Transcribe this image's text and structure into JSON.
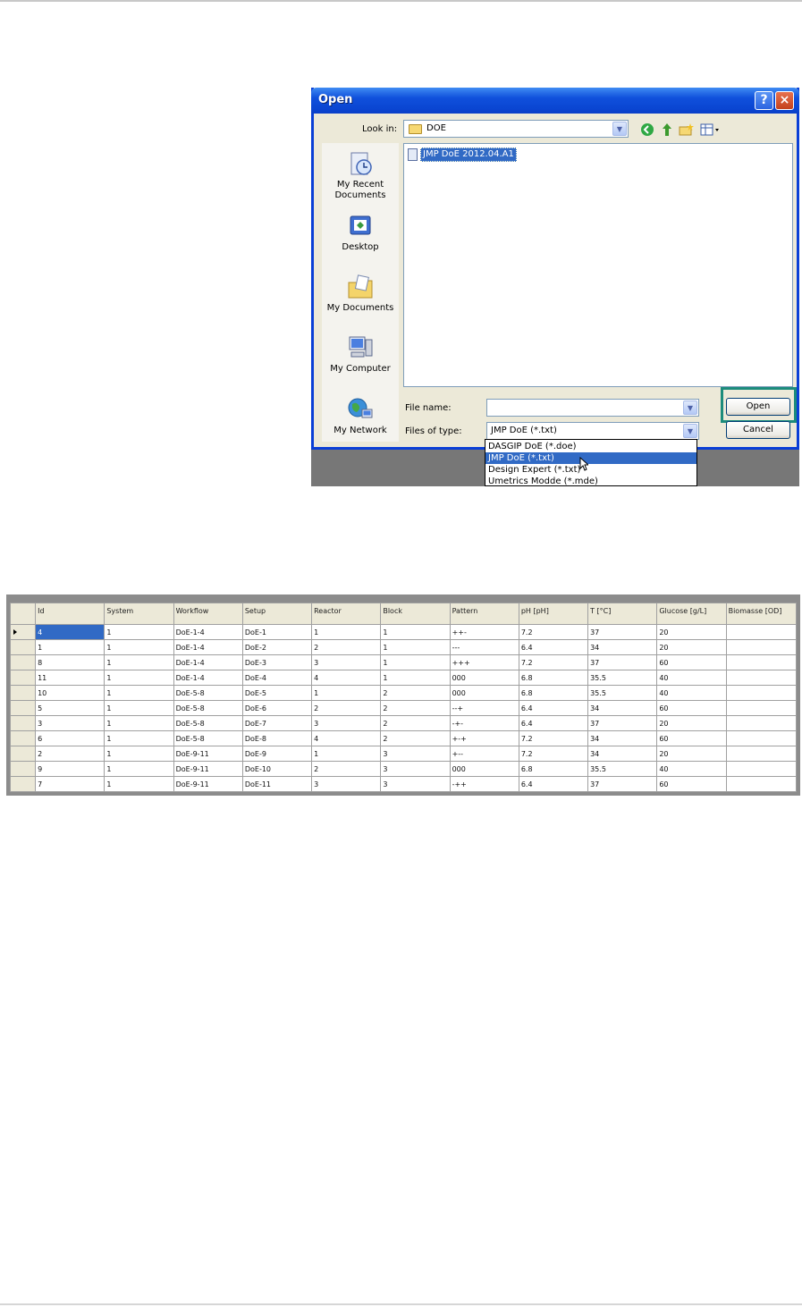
{
  "dialog": {
    "title": "Open",
    "help_label": "?",
    "close_label": "×",
    "look_in_label": "Look in:",
    "look_in_value": "DOE",
    "places": [
      {
        "label": "My Recent Documents",
        "icon": "recent-documents-icon"
      },
      {
        "label": "Desktop",
        "icon": "desktop-icon"
      },
      {
        "label": "My Documents",
        "icon": "my-documents-icon"
      },
      {
        "label": "My Computer",
        "icon": "my-computer-icon"
      },
      {
        "label": "My Network",
        "icon": "my-network-icon"
      }
    ],
    "files": [
      "JMP DoE 2012.04.A1"
    ],
    "file_name_label": "File name:",
    "file_name_value": "",
    "files_of_type_label": "Files of type:",
    "files_of_type_value": "JMP DoE (*.txt)",
    "open_label": "Open",
    "cancel_label": "Cancel",
    "type_options": [
      "DASGIP DoE (*.doe)",
      "JMP DoE (*.txt)",
      "Design Expert (*.txt)",
      "Umetrics Modde (*.mde)"
    ],
    "selected_type_index": 1
  },
  "grid": {
    "columns": [
      "Id",
      "System",
      "Workflow",
      "Setup",
      "Reactor",
      "Block",
      "Pattern",
      "pH [pH]",
      "T [°C]",
      "Glucose [g/L]",
      "Biomasse [OD]"
    ],
    "rows": [
      [
        "4",
        "1",
        "DoE-1-4",
        "DoE-1",
        "1",
        "1",
        "++-",
        "7.2",
        "37",
        "20",
        ""
      ],
      [
        "1",
        "1",
        "DoE-1-4",
        "DoE-2",
        "2",
        "1",
        "---",
        "6.4",
        "34",
        "20",
        ""
      ],
      [
        "8",
        "1",
        "DoE-1-4",
        "DoE-3",
        "3",
        "1",
        "+++",
        "7.2",
        "37",
        "60",
        ""
      ],
      [
        "11",
        "1",
        "DoE-1-4",
        "DoE-4",
        "4",
        "1",
        "000",
        "6.8",
        "35.5",
        "40",
        ""
      ],
      [
        "10",
        "1",
        "DoE-5-8",
        "DoE-5",
        "1",
        "2",
        "000",
        "6.8",
        "35.5",
        "40",
        ""
      ],
      [
        "5",
        "1",
        "DoE-5-8",
        "DoE-6",
        "2",
        "2",
        "--+",
        "6.4",
        "34",
        "60",
        ""
      ],
      [
        "3",
        "1",
        "DoE-5-8",
        "DoE-7",
        "3",
        "2",
        "-+-",
        "6.4",
        "37",
        "20",
        ""
      ],
      [
        "6",
        "1",
        "DoE-5-8",
        "DoE-8",
        "4",
        "2",
        "+-+",
        "7.2",
        "34",
        "60",
        ""
      ],
      [
        "2",
        "1",
        "DoE-9-11",
        "DoE-9",
        "1",
        "3",
        "+--",
        "7.2",
        "34",
        "20",
        ""
      ],
      [
        "9",
        "1",
        "DoE-9-11",
        "DoE-10",
        "2",
        "3",
        "000",
        "6.8",
        "35.5",
        "40",
        ""
      ],
      [
        "7",
        "1",
        "DoE-9-11",
        "DoE-11",
        "3",
        "3",
        "-++",
        "6.4",
        "37",
        "60",
        ""
      ]
    ],
    "current_row": 0
  }
}
